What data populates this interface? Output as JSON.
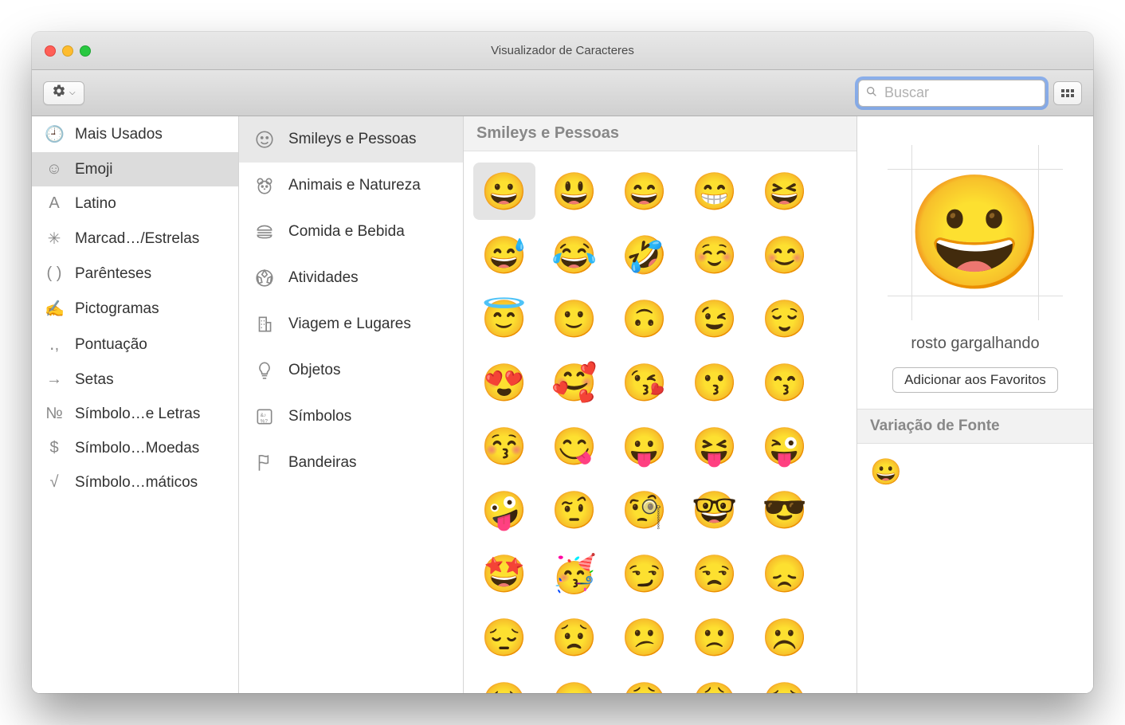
{
  "window": {
    "title": "Visualizador de Caracteres"
  },
  "search": {
    "placeholder": "Buscar",
    "value": ""
  },
  "sidebar1": {
    "items": [
      {
        "icon": "🕘",
        "label": "Mais Usados"
      },
      {
        "icon": "☺",
        "label": "Emoji",
        "selected": true
      },
      {
        "icon": "A",
        "label": "Latino"
      },
      {
        "icon": "✳",
        "label": "Marcad…/Estrelas"
      },
      {
        "icon": "( )",
        "label": "Parênteses"
      },
      {
        "icon": "✍",
        "label": "Pictogramas"
      },
      {
        "icon": "․,",
        "label": "Pontuação"
      },
      {
        "icon": "→",
        "label": "Setas"
      },
      {
        "icon": "№",
        "label": "Símbolo…e Letras"
      },
      {
        "icon": "$",
        "label": "Símbolo…Moedas"
      },
      {
        "icon": "√",
        "label": "Símbolo…máticos"
      }
    ]
  },
  "sidebar2": {
    "items": [
      {
        "icon": "smiley",
        "label": "Smileys e Pessoas",
        "selected": true
      },
      {
        "icon": "bear",
        "label": "Animais e Natureza"
      },
      {
        "icon": "burger",
        "label": "Comida e Bebida"
      },
      {
        "icon": "soccer",
        "label": "Atividades"
      },
      {
        "icon": "building",
        "label": "Viagem e Lugares"
      },
      {
        "icon": "bulb",
        "label": "Objetos"
      },
      {
        "icon": "symbols",
        "label": "Símbolos"
      },
      {
        "icon": "flag",
        "label": "Bandeiras"
      }
    ]
  },
  "main": {
    "header": "Smileys e Pessoas",
    "selected_index": 0,
    "emojis": [
      "😀",
      "😃",
      "😄",
      "😁",
      "😆",
      "😅",
      "😂",
      "🤣",
      "☺️",
      "😊",
      "😇",
      "🙂",
      "🙃",
      "😉",
      "😌",
      "😍",
      "🥰",
      "😘",
      "😗",
      "😙",
      "😚",
      "😋",
      "😛",
      "😝",
      "😜",
      "🤪",
      "🤨",
      "🧐",
      "🤓",
      "😎",
      "🤩",
      "🥳",
      "😏",
      "😒",
      "😞",
      "😔",
      "😟",
      "😕",
      "🙁",
      "☹️",
      "😣",
      "😖",
      "😫",
      "😩",
      "🥺"
    ]
  },
  "detail": {
    "character": "😀",
    "name": "rosto gargalhando",
    "add_favorites_label": "Adicionar aos Favoritos",
    "variation_header": "Variação de Fonte",
    "variation": "😀"
  }
}
